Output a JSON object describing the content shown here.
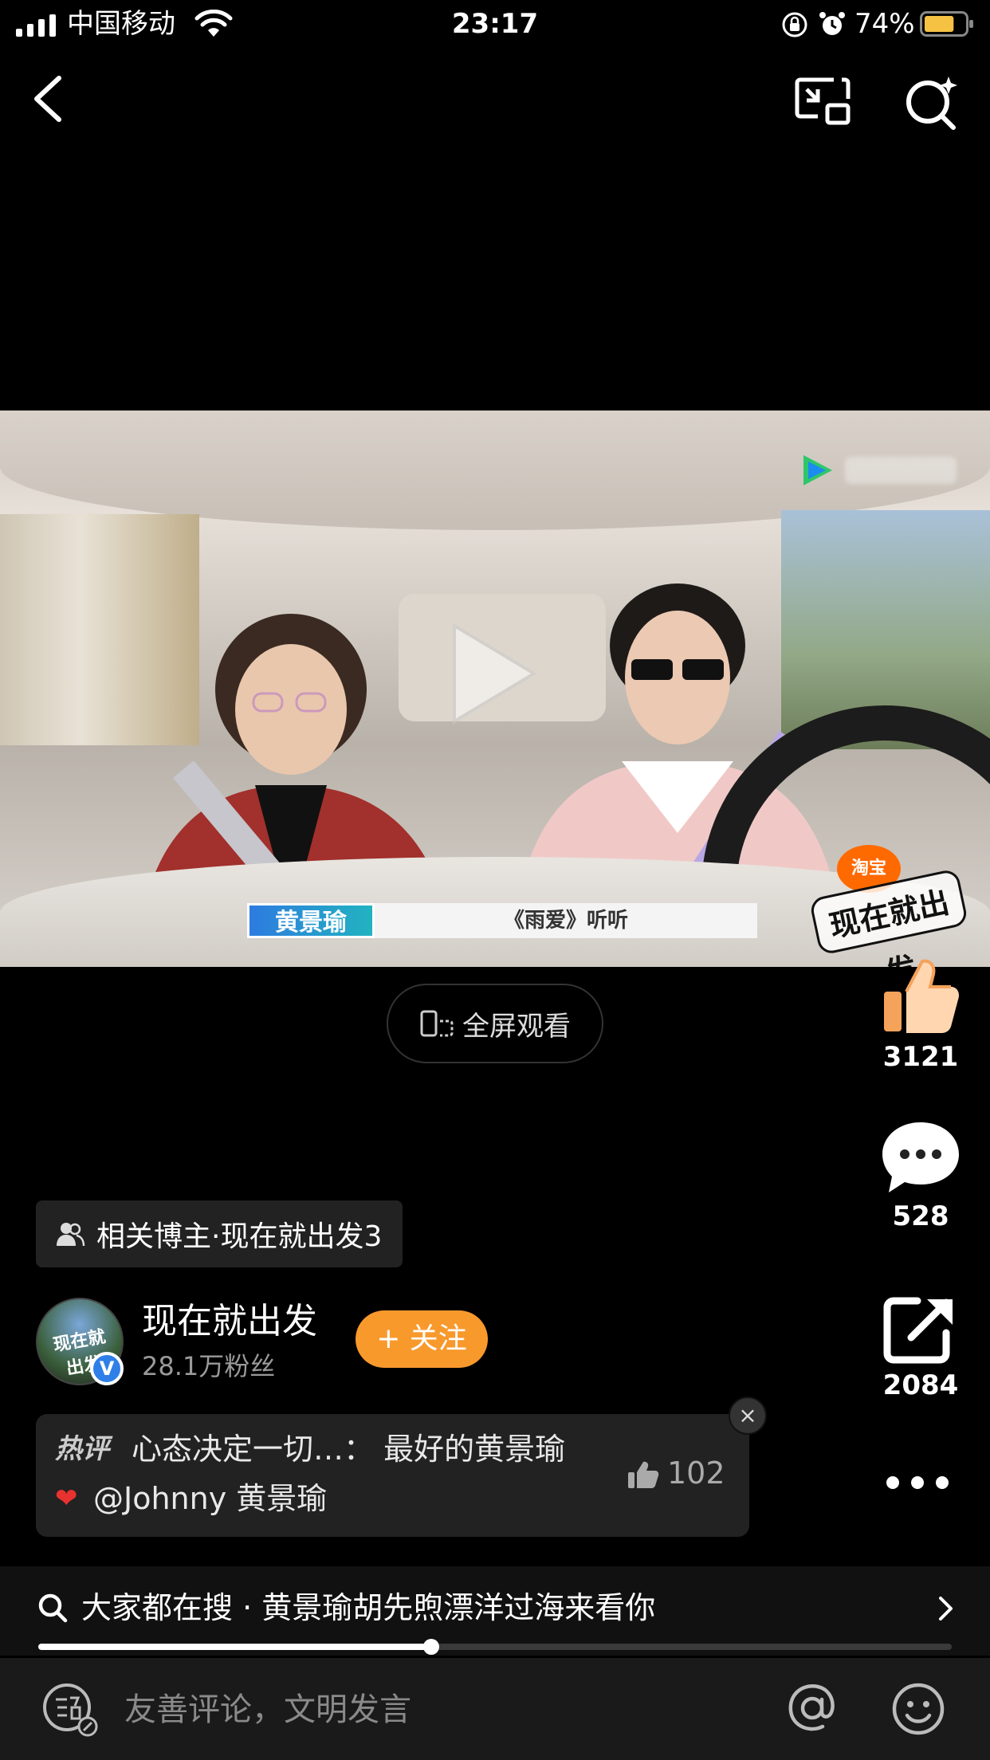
{
  "status_bar": {
    "carrier": "中国移动",
    "time": "23:17",
    "battery_percent": "74%",
    "battery_level": 0.74
  },
  "nav": {
    "back_icon": "chevron-left-icon",
    "pip_icon": "picture-in-picture-icon",
    "search_icon": "search-sparkle-icon"
  },
  "video": {
    "subtitle_name": "黄景瑜",
    "subtitle_text": "《雨爱》听听",
    "brand_badge": "淘宝",
    "brand_title": "现在就出发"
  },
  "fullscreen": {
    "label": "全屏观看"
  },
  "actions": {
    "likes": "3121",
    "comments": "528",
    "shares": "2084"
  },
  "related": {
    "label": "相关博主·现在就出发3"
  },
  "author": {
    "name": "现在就出发",
    "fans": "28.1万粉丝",
    "follow_label": "+ 关注",
    "avatar_text": "现在就出发",
    "verified_mark": "V"
  },
  "hot_comment": {
    "tag": "热评",
    "line1": "心态决定一切…：  最好的黄景瑜",
    "heart": "❤",
    "line2": "@Johnny 黄景瑜",
    "likes": "102",
    "close": "×"
  },
  "search_suggest": {
    "text": "大家都在搜 · 黄景瑜胡先煦漂洋过海来看你"
  },
  "playback": {
    "progress": 0.43
  },
  "comment_bar": {
    "placeholder": "友善评论，文明发言"
  },
  "colors": {
    "follow": "#f8992c",
    "like": "#f5a25b",
    "verified": "#2f7fe8"
  }
}
